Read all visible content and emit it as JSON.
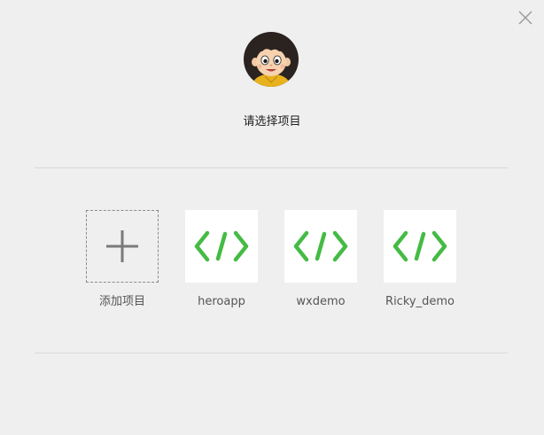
{
  "header": {
    "title": "请选择项目"
  },
  "projects": [
    {
      "label": "添加项目",
      "icon": "plus-icon"
    },
    {
      "label": "heroapp",
      "icon": "code-icon"
    },
    {
      "label": "wxdemo",
      "icon": "code-icon"
    },
    {
      "label": "Ricky_demo",
      "icon": "code-icon"
    }
  ],
  "colors": {
    "accent": "#44bb44",
    "background": "#efefef",
    "tile": "#ffffff"
  }
}
